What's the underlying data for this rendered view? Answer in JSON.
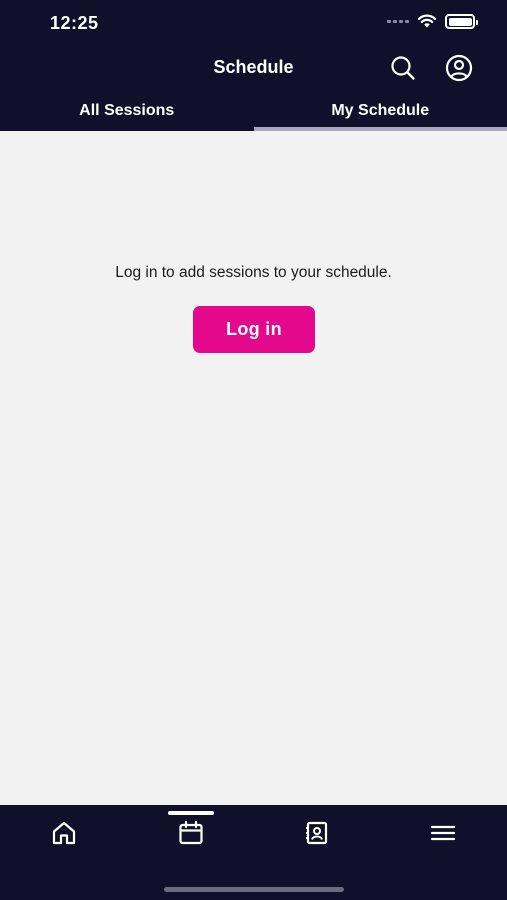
{
  "status": {
    "time": "12:25"
  },
  "header": {
    "title": "Schedule"
  },
  "tabs": [
    {
      "label": "All Sessions",
      "active": false
    },
    {
      "label": "My Schedule",
      "active": true
    }
  ],
  "main": {
    "message": "Log in to add sessions to your schedule.",
    "login_label": "Log in"
  },
  "bottom_nav": {
    "items": [
      {
        "icon": "home-icon"
      },
      {
        "icon": "calendar-icon",
        "active": true
      },
      {
        "icon": "contact-card-icon"
      },
      {
        "icon": "hamburger-menu-icon"
      }
    ]
  },
  "colors": {
    "navy": "#120f2a",
    "accent": "#e4088c",
    "background": "#f2f2f2"
  }
}
